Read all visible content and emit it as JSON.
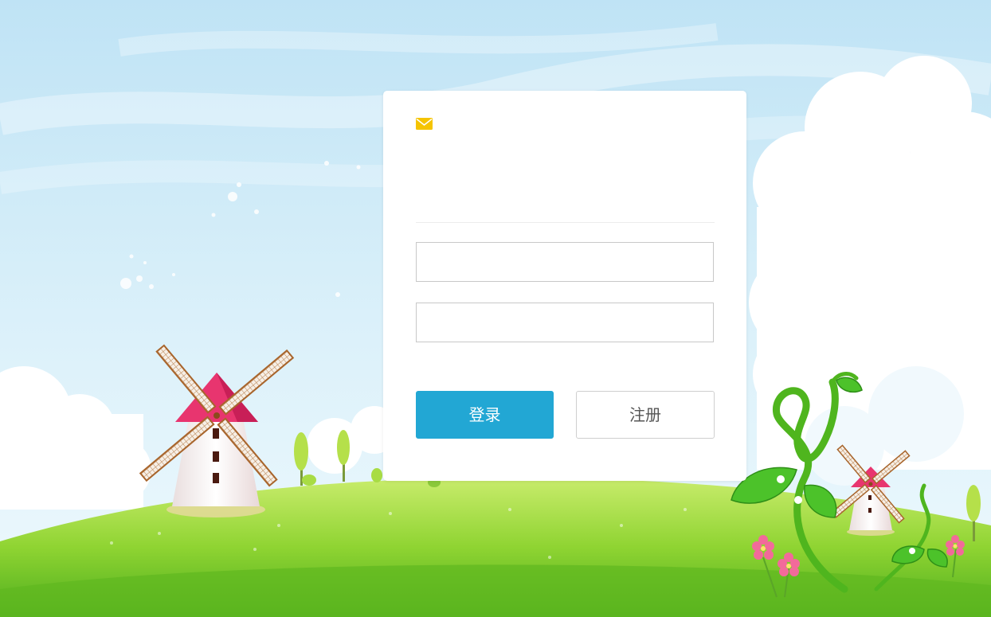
{
  "login": {
    "login_button": "登录",
    "register_button": "注册"
  },
  "colors": {
    "accent": "#22a7d4",
    "mail_icon": "#f5c400",
    "sky": "#cdeaf6",
    "grass": "#8cd630"
  },
  "icons": {
    "header": "mail-icon"
  }
}
